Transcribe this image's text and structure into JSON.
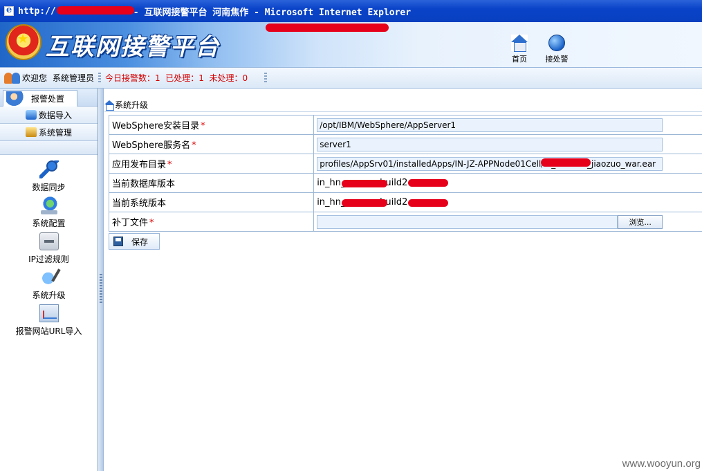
{
  "window": {
    "title_prefix": "http://",
    "title_main": " - 互联网接警平台 河南焦作 - Microsoft Internet Explorer"
  },
  "header": {
    "brand": "互联网接警平台",
    "nav": [
      {
        "label": "首页",
        "icon": "home-icon"
      },
      {
        "label": "接处警",
        "icon": "globe-icon"
      }
    ]
  },
  "status": {
    "welcome": "欢迎您",
    "user": "系统管理员",
    "stats": "今日接警数：1  已处理：1  未处理：0"
  },
  "sidebar": {
    "header": "报警处置",
    "menu": [
      {
        "label": "数据导入",
        "icon": "import-icon"
      },
      {
        "label": "系统管理",
        "icon": "folder-icon"
      }
    ],
    "items": [
      {
        "label": "数据同步",
        "icon": "key-icon"
      },
      {
        "label": "系统配置",
        "icon": "network-config-icon"
      },
      {
        "label": "IP过滤规则",
        "icon": "ip-filter-icon"
      },
      {
        "label": "系统升级",
        "icon": "upgrade-icon"
      },
      {
        "label": "报警网站URL导入",
        "icon": "url-import-icon"
      }
    ]
  },
  "main": {
    "breadcrumb": "系统升级",
    "fields": [
      {
        "label": "WebSphere安装目录",
        "required": "*",
        "value": "/opt/IBM/WebSphere/AppServer1"
      },
      {
        "label": "WebSphere服务名",
        "required": "*",
        "value": "server1"
      },
      {
        "label": "应用发布目录",
        "required": "*",
        "value": "profiles/AppSrv01/installedApps/IN-JZ-APPNode01Cell/in_h          _jiaozuo_war.ear"
      },
      {
        "label": "当前数据库版本",
        "required": "",
        "value": "in_hn_            build2         "
      },
      {
        "label": "当前系统版本",
        "required": "",
        "value": "in_hn_            build2         "
      },
      {
        "label": "补丁文件",
        "required": "*",
        "value": ""
      }
    ],
    "browse_label": "浏览...",
    "save_label": "保存"
  },
  "watermark": "www.wooyun.org",
  "colors": {
    "titlebar": "#0a43c8",
    "alert_red": "#d40000",
    "redaction": "#e6001a",
    "input_bg": "#eaf3fd"
  }
}
